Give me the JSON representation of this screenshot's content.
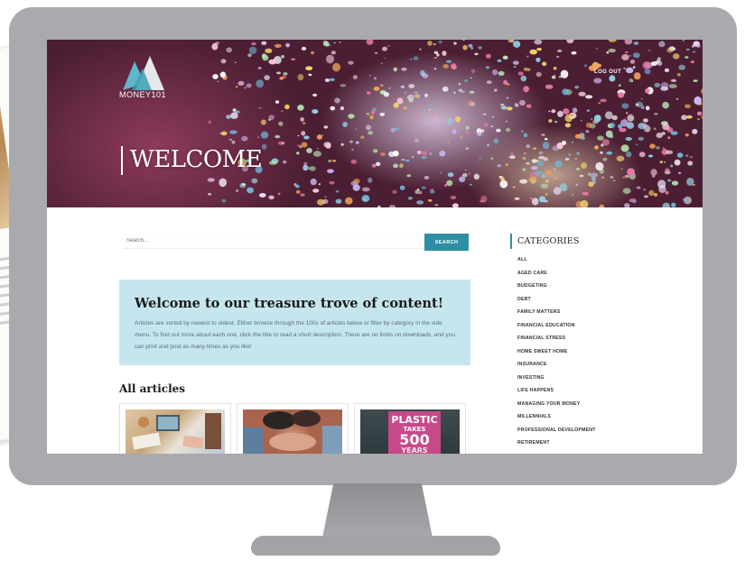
{
  "header": {
    "logo_text": "MONEY101",
    "logout_label": "LOG OUT",
    "welcome_title": "WELCOME"
  },
  "search": {
    "placeholder": "Search...",
    "button_label": "SEARCH"
  },
  "intro": {
    "title": "Welcome to our treasure trove of content!",
    "text": "Articles are sorted by newest to oldest. Either browse through the 100s of articles below or filter by category in the side menu. To find out more about each one, click the title to read a short description. There are no limits on downloads, and you can print and post as many times as you like!"
  },
  "articles": {
    "heading": "All articles",
    "cards": [
      {
        "thumb": "office-desk-photo"
      },
      {
        "thumb": "hands-holding-photo"
      },
      {
        "thumb": "plastic-sign-photo",
        "sign_text": [
          "PLASTIC",
          "TAKES",
          "500",
          "YEARS"
        ]
      }
    ]
  },
  "categories": {
    "title": "CATEGORIES",
    "items": [
      "ALL",
      "AGED CARE",
      "BUDGETING",
      "DEBT",
      "FAMILY MATTERS",
      "FINANCIAL EDUCATION",
      "FINANCIAL STRESS",
      "HOME SWEET HOME",
      "INSURANCE",
      "INVESTING",
      "LIFE HAPPENS",
      "MANAGING YOUR MONEY",
      "MILLENNIALS",
      "PROFESSIONAL DEVELOPMENT",
      "RETIREMENT"
    ]
  },
  "colors": {
    "accent": "#2e8fa4",
    "intro_bg": "#c6e6ee",
    "monitor": "#a9aaad"
  }
}
